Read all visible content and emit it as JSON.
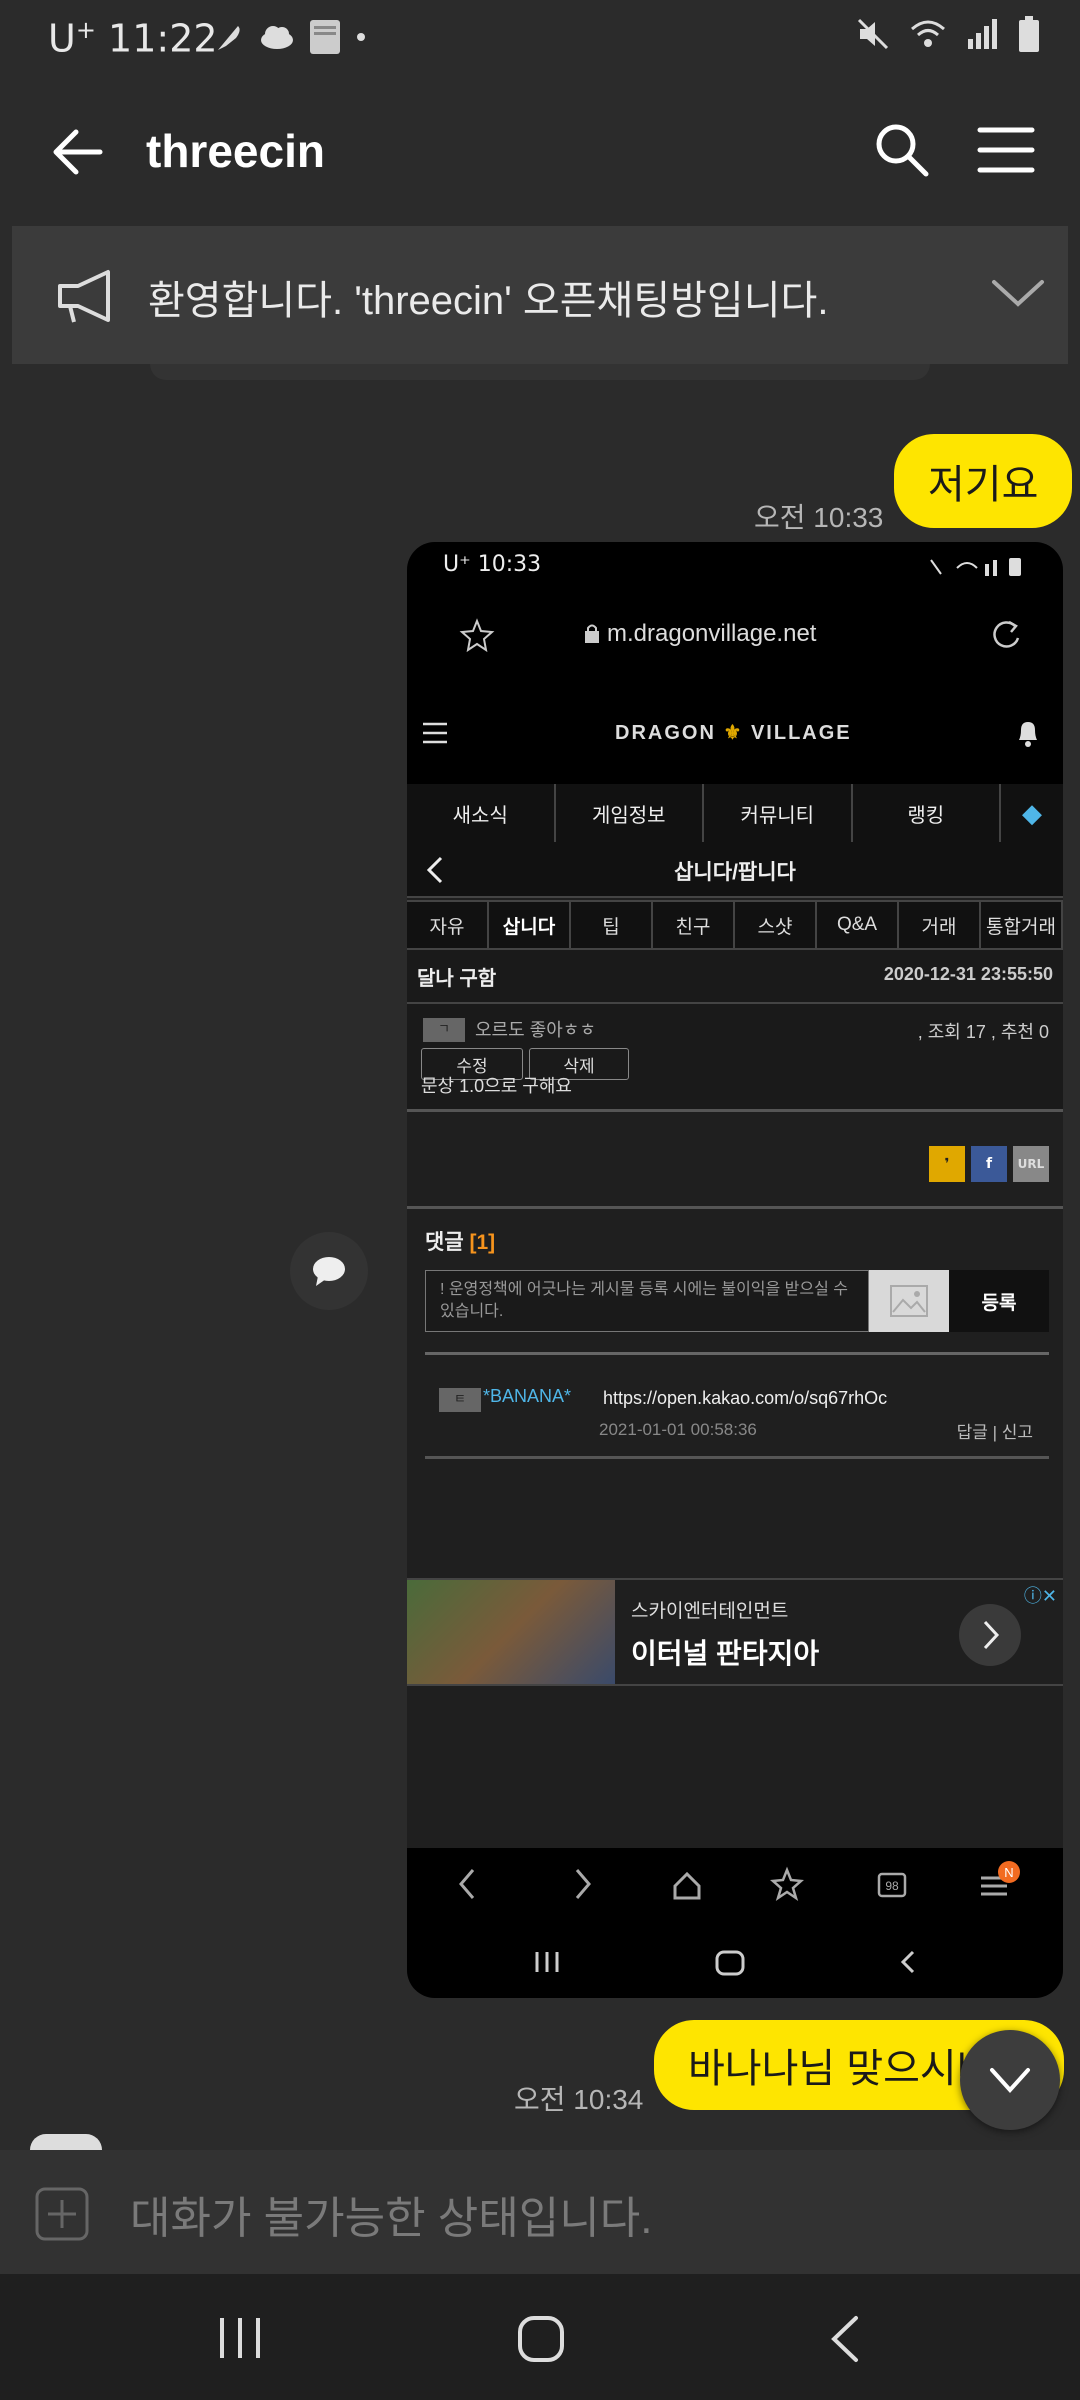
{
  "status_bar": {
    "carrier": "U",
    "carrier_sup": "+",
    "time": "11:22"
  },
  "header": {
    "title": "threecin"
  },
  "notice": {
    "text": "환영합니다. 'threecin' 오픈채팅방입니다."
  },
  "messages": [
    {
      "text": "저기요",
      "time": "오전 10:33"
    },
    {
      "text": "바나나님 맞으시나요",
      "time": "오전 10:34"
    }
  ],
  "screenshot": {
    "status_time": "U⁺ 10:33",
    "url": "m.dragonvillage.net",
    "logo_left": "DRAGON",
    "logo_right": "VILLAGE",
    "top_nav": [
      "새소식",
      "게임정보",
      "커뮤니티",
      "랭킹"
    ],
    "board_title": "삽니다/팝니다",
    "sub_tabs": [
      "자유",
      "삽니다",
      "팁",
      "친구",
      "스샷",
      "Q&A",
      "거래",
      "통합거래"
    ],
    "post_title": "달나 구함",
    "post_date": "2020-12-31 23:55:50",
    "author_level": "ㄱ",
    "author": "오르도 좋아ㅎㅎ",
    "stats": ", 조회 17 , 추천 0",
    "edit_label": "수정",
    "delete_label": "삭제",
    "body": "문상 1.0으로 구해요",
    "share": {
      "kakao": "❜",
      "facebook": "f",
      "url": "URL"
    },
    "comments_label": "댓글",
    "comments_count": "[1]",
    "comment_placeholder": "! 운영정책에 어긋나는 게시물 등록 시에는 불이익을 받으실 수 있습니다.",
    "comment_submit": "등록",
    "comment": {
      "level": "ㅌ",
      "user": "*BANANA*",
      "text": "https://open.kakao.com/o/sq67rhOc",
      "date": "2021-01-01 00:58:36",
      "actions": "답글 | 신고"
    },
    "ad": {
      "brand": "스카이엔터테인먼트",
      "name": "이터널 판타지아",
      "info": "ⓘ✕"
    },
    "browser_badge": "N",
    "tabs_count": "98"
  },
  "input_bar": {
    "placeholder": "대화가 불가능한 상태입니다."
  },
  "colors": {
    "bubble": "#fee500",
    "background": "#2b2b2b",
    "accent_blue": "#4fb6e8",
    "accent_orange": "#f7941d"
  }
}
